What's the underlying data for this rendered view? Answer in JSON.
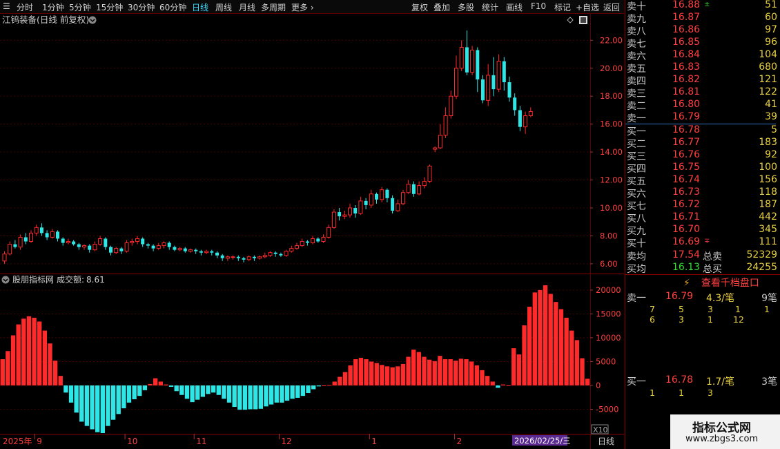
{
  "toolbar": {
    "periods": [
      "分时",
      "1分钟",
      "5分钟",
      "15分钟",
      "30分钟",
      "60分钟",
      "日线",
      "周线",
      "月线",
      "多周期",
      "更多"
    ],
    "selected": "日线",
    "tools": [
      "复权",
      "叠加",
      "多股",
      "统计",
      "画线",
      "F10",
      "标记",
      "+自选",
      "返回"
    ]
  },
  "main_chart": {
    "title": "江钨装备(日线 前复权)"
  },
  "sub_chart": {
    "title": "股朋指标网",
    "metric_label": "成交额:",
    "metric_value": "8.61",
    "scale_label": "X10"
  },
  "axis": {
    "year_label": "2025年",
    "date_badge": "2026/02/25/三",
    "period_button": "日线"
  },
  "colors": {
    "up": "#ff2a2a",
    "down": "#2ee6e6",
    "bg": "#000000",
    "grid": "#5a0000",
    "accent": "#3fd8ff"
  },
  "chart_data": [
    {
      "type": "candlestick",
      "title": "江钨装备(日线 前复权)",
      "ylim": [
        5.5,
        23.5
      ],
      "yticks": [
        "6.00",
        "8.00",
        "10.00",
        "12.00",
        "14.00",
        "16.00",
        "18.00",
        "20.00",
        "22.00"
      ],
      "xticks": [
        "9",
        "10",
        "11",
        "12",
        "1",
        "2"
      ],
      "xtick_index": [
        6,
        23,
        36,
        52,
        69,
        85
      ],
      "candles": [
        [
          6.2,
          6.7,
          6.0,
          6.9
        ],
        [
          6.7,
          7.4,
          6.6,
          7.6
        ],
        [
          7.4,
          7.2,
          7.1,
          7.7
        ],
        [
          7.2,
          7.9,
          7.0,
          8.1
        ],
        [
          7.9,
          7.6,
          7.4,
          8.2
        ],
        [
          7.6,
          8.2,
          7.5,
          8.4
        ],
        [
          8.2,
          8.6,
          8.0,
          8.8
        ],
        [
          8.6,
          8.2,
          8.0,
          8.9
        ],
        [
          8.2,
          7.9,
          7.7,
          8.4
        ],
        [
          7.9,
          8.3,
          7.8,
          8.5
        ],
        [
          8.3,
          7.8,
          7.6,
          8.4
        ],
        [
          7.8,
          7.5,
          7.3,
          7.9
        ],
        [
          7.5,
          7.6,
          7.4,
          7.8
        ],
        [
          7.6,
          7.4,
          7.3,
          7.7
        ],
        [
          7.4,
          7.2,
          7.0,
          7.5
        ],
        [
          7.2,
          7.3,
          7.0,
          7.4
        ],
        [
          7.3,
          7.0,
          6.8,
          7.4
        ],
        [
          7.0,
          7.4,
          6.9,
          7.6
        ],
        [
          7.4,
          7.8,
          7.3,
          8.0
        ],
        [
          7.8,
          7.2,
          7.0,
          7.9
        ],
        [
          7.2,
          6.8,
          6.6,
          7.3
        ],
        [
          6.8,
          7.1,
          6.7,
          7.2
        ],
        [
          7.1,
          6.9,
          6.7,
          7.2
        ],
        [
          6.9,
          7.5,
          6.8,
          7.7
        ],
        [
          7.5,
          7.6,
          7.3,
          7.8
        ],
        [
          7.6,
          7.8,
          7.4,
          8.0
        ],
        [
          7.8,
          7.4,
          7.2,
          7.9
        ],
        [
          7.4,
          7.3,
          7.1,
          7.5
        ],
        [
          7.3,
          7.1,
          6.9,
          7.4
        ],
        [
          7.1,
          7.3,
          7.0,
          7.5
        ],
        [
          7.3,
          7.5,
          7.1,
          7.6
        ],
        [
          7.5,
          7.2,
          7.0,
          7.6
        ],
        [
          7.2,
          7.0,
          6.9,
          7.3
        ],
        [
          7.0,
          7.1,
          6.9,
          7.2
        ],
        [
          7.1,
          6.9,
          6.8,
          7.2
        ],
        [
          6.9,
          7.0,
          6.8,
          7.1
        ],
        [
          7.0,
          6.9,
          6.7,
          7.1
        ],
        [
          6.9,
          6.8,
          6.6,
          7.0
        ],
        [
          6.8,
          6.9,
          6.7,
          7.0
        ],
        [
          6.9,
          6.8,
          6.6,
          7.0
        ],
        [
          6.8,
          6.6,
          6.4,
          6.9
        ],
        [
          6.6,
          6.4,
          6.2,
          6.7
        ],
        [
          6.4,
          6.5,
          6.2,
          6.6
        ],
        [
          6.5,
          6.5,
          6.3,
          6.6
        ],
        [
          6.5,
          6.4,
          6.2,
          6.6
        ],
        [
          6.4,
          6.3,
          6.1,
          6.5
        ],
        [
          6.3,
          6.5,
          6.2,
          6.6
        ],
        [
          6.5,
          6.4,
          6.2,
          6.6
        ],
        [
          6.4,
          6.5,
          6.3,
          6.6
        ],
        [
          6.5,
          6.6,
          6.4,
          6.8
        ],
        [
          6.6,
          6.8,
          6.5,
          6.9
        ],
        [
          6.8,
          6.7,
          6.5,
          6.9
        ],
        [
          6.7,
          6.6,
          6.5,
          6.8
        ],
        [
          6.6,
          6.9,
          6.5,
          7.0
        ],
        [
          6.9,
          7.1,
          6.8,
          7.3
        ],
        [
          7.1,
          7.3,
          7.0,
          7.5
        ],
        [
          7.3,
          7.6,
          7.2,
          7.8
        ],
        [
          7.6,
          7.5,
          7.3,
          7.7
        ],
        [
          7.5,
          7.8,
          7.4,
          8.0
        ],
        [
          7.8,
          7.6,
          7.5,
          7.9
        ],
        [
          7.6,
          7.9,
          7.5,
          8.1
        ],
        [
          7.9,
          8.6,
          7.8,
          8.8
        ],
        [
          8.6,
          9.7,
          8.5,
          9.9
        ],
        [
          9.7,
          9.4,
          9.1,
          10.0
        ],
        [
          9.4,
          9.5,
          9.2,
          9.8
        ],
        [
          9.5,
          10.0,
          9.3,
          10.3
        ],
        [
          10.0,
          9.6,
          9.3,
          10.2
        ],
        [
          9.6,
          10.5,
          9.5,
          10.8
        ],
        [
          10.5,
          10.2,
          9.9,
          10.7
        ],
        [
          10.2,
          11.0,
          10.0,
          11.3
        ],
        [
          11.0,
          10.6,
          10.3,
          11.1
        ],
        [
          10.6,
          11.3,
          10.4,
          11.5
        ],
        [
          11.3,
          10.7,
          10.4,
          11.4
        ],
        [
          10.7,
          9.8,
          9.6,
          10.9
        ],
        [
          9.8,
          10.3,
          9.7,
          10.6
        ],
        [
          10.3,
          11.1,
          10.2,
          11.3
        ],
        [
          11.1,
          11.7,
          11.0,
          12.0
        ],
        [
          11.7,
          11.0,
          10.8,
          11.9
        ],
        [
          11.0,
          11.6,
          10.9,
          11.9
        ],
        [
          11.6,
          11.9,
          11.4,
          12.2
        ],
        [
          11.9,
          13.0,
          11.8,
          13.1
        ],
        [
          14.2,
          14.3,
          14.0,
          14.4
        ],
        [
          14.3,
          15.2,
          14.2,
          16.0
        ],
        [
          15.2,
          16.6,
          15.0,
          17.2
        ],
        [
          16.6,
          18.0,
          16.4,
          18.4
        ],
        [
          18.0,
          20.0,
          17.8,
          20.9
        ],
        [
          20.0,
          21.5,
          19.8,
          22.0
        ],
        [
          21.5,
          19.7,
          19.5,
          22.7
        ],
        [
          19.7,
          21.3,
          19.5,
          21.6
        ],
        [
          21.3,
          19.2,
          18.3,
          21.5
        ],
        [
          19.2,
          17.7,
          17.5,
          19.5
        ],
        [
          17.7,
          19.5,
          17.3,
          20.3
        ],
        [
          19.5,
          18.5,
          18.0,
          20.8
        ],
        [
          18.5,
          20.5,
          18.3,
          21.0
        ],
        [
          20.5,
          19.0,
          18.4,
          20.8
        ],
        [
          19.0,
          17.9,
          17.6,
          19.4
        ],
        [
          17.9,
          17.0,
          16.6,
          18.2
        ],
        [
          17.0,
          15.8,
          15.5,
          17.3
        ],
        [
          15.8,
          16.6,
          15.3,
          16.9
        ],
        [
          16.6,
          16.9,
          16.5,
          17.2
        ]
      ]
    },
    {
      "type": "bar",
      "title": "股朋指标网 成交额: 8.61",
      "ylim": [
        -10000,
        21000
      ],
      "yticks": [
        "20000",
        "15000",
        "10000",
        "5000",
        "0",
        "-5000"
      ],
      "values": [
        5500,
        7200,
        10500,
        12800,
        14000,
        14500,
        14200,
        13400,
        11500,
        8800,
        5200,
        2000,
        -1500,
        -3600,
        -5700,
        -7600,
        -8500,
        -9200,
        -9800,
        -10000,
        -8500,
        -7200,
        -6000,
        -4800,
        -3600,
        -2900,
        -2200,
        -1000,
        300,
        1500,
        800,
        200,
        -300,
        -1200,
        -2000,
        -2800,
        -3500,
        -3000,
        -2400,
        -1800,
        -1500,
        -2000,
        -2800,
        -3600,
        -4500,
        -5100,
        -5100,
        -5000,
        -5000,
        -4900,
        -4400,
        -4000,
        -3600,
        -3600,
        -3200,
        -2800,
        -2600,
        -2200,
        -1600,
        -800,
        -200,
        0,
        100,
        800,
        1800,
        2800,
        4200,
        5500,
        5800,
        5500,
        5000,
        4700,
        4300,
        4000,
        3800,
        4000,
        4500,
        6000,
        7500,
        7000,
        6000,
        5400,
        5100,
        6200,
        5500,
        5500,
        5200,
        5600,
        5500,
        5000,
        4200,
        3200,
        2000,
        800,
        -500,
        200,
        0,
        7800,
        6500,
        12600,
        16500,
        19500,
        20000,
        21000,
        19200,
        17500,
        16000,
        14200,
        11500,
        9500,
        5700,
        1400
      ]
    }
  ],
  "orderbook": {
    "asks": [
      {
        "label": "卖十",
        "price": "16.88",
        "vol": "51",
        "mark": "±"
      },
      {
        "label": "卖九",
        "price": "16.87",
        "vol": "60"
      },
      {
        "label": "卖八",
        "price": "16.86",
        "vol": "97"
      },
      {
        "label": "卖七",
        "price": "16.85",
        "vol": "96"
      },
      {
        "label": "卖六",
        "price": "16.84",
        "vol": "104"
      },
      {
        "label": "卖五",
        "price": "16.83",
        "vol": "680"
      },
      {
        "label": "卖四",
        "price": "16.82",
        "vol": "121"
      },
      {
        "label": "卖三",
        "price": "16.81",
        "vol": "122"
      },
      {
        "label": "卖二",
        "price": "16.80",
        "vol": "41"
      },
      {
        "label": "卖一",
        "price": "16.79",
        "vol": "39"
      }
    ],
    "bids": [
      {
        "label": "买一",
        "price": "16.78",
        "vol": "5"
      },
      {
        "label": "买二",
        "price": "16.77",
        "vol": "183"
      },
      {
        "label": "买三",
        "price": "16.76",
        "vol": "92"
      },
      {
        "label": "买四",
        "price": "16.75",
        "vol": "100"
      },
      {
        "label": "买五",
        "price": "16.74",
        "vol": "156"
      },
      {
        "label": "买六",
        "price": "16.73",
        "vol": "118"
      },
      {
        "label": "买七",
        "price": "16.72",
        "vol": "187"
      },
      {
        "label": "买八",
        "price": "16.71",
        "vol": "442"
      },
      {
        "label": "买九",
        "price": "16.70",
        "vol": "345"
      },
      {
        "label": "买十",
        "price": "16.69",
        "vol": "111",
        "mark": "∓"
      }
    ],
    "ask_avg": {
      "label": "卖均",
      "value": "17.54",
      "total_label": "总卖",
      "total": "52329"
    },
    "bid_avg": {
      "label": "买均",
      "value": "16.13",
      "total_label": "总买",
      "total": "24255"
    },
    "thousand_button": "查看千档盘口",
    "ask1_detail": {
      "label": "卖一",
      "price": "16.79",
      "avg": "4.3/笔",
      "count": "9笔",
      "rows": [
        [
          "7",
          "5",
          "3",
          "1",
          "1"
        ],
        [
          "6",
          "3",
          "1",
          "12"
        ]
      ]
    },
    "bid1_detail": {
      "label": "买一",
      "price": "16.78",
      "avg": "1.7/笔",
      "count": "3笔",
      "rows": [
        [
          "1",
          "1",
          "3"
        ]
      ]
    }
  },
  "watermark": {
    "title": "指标公式网",
    "url": "www.zbgs3.com"
  }
}
